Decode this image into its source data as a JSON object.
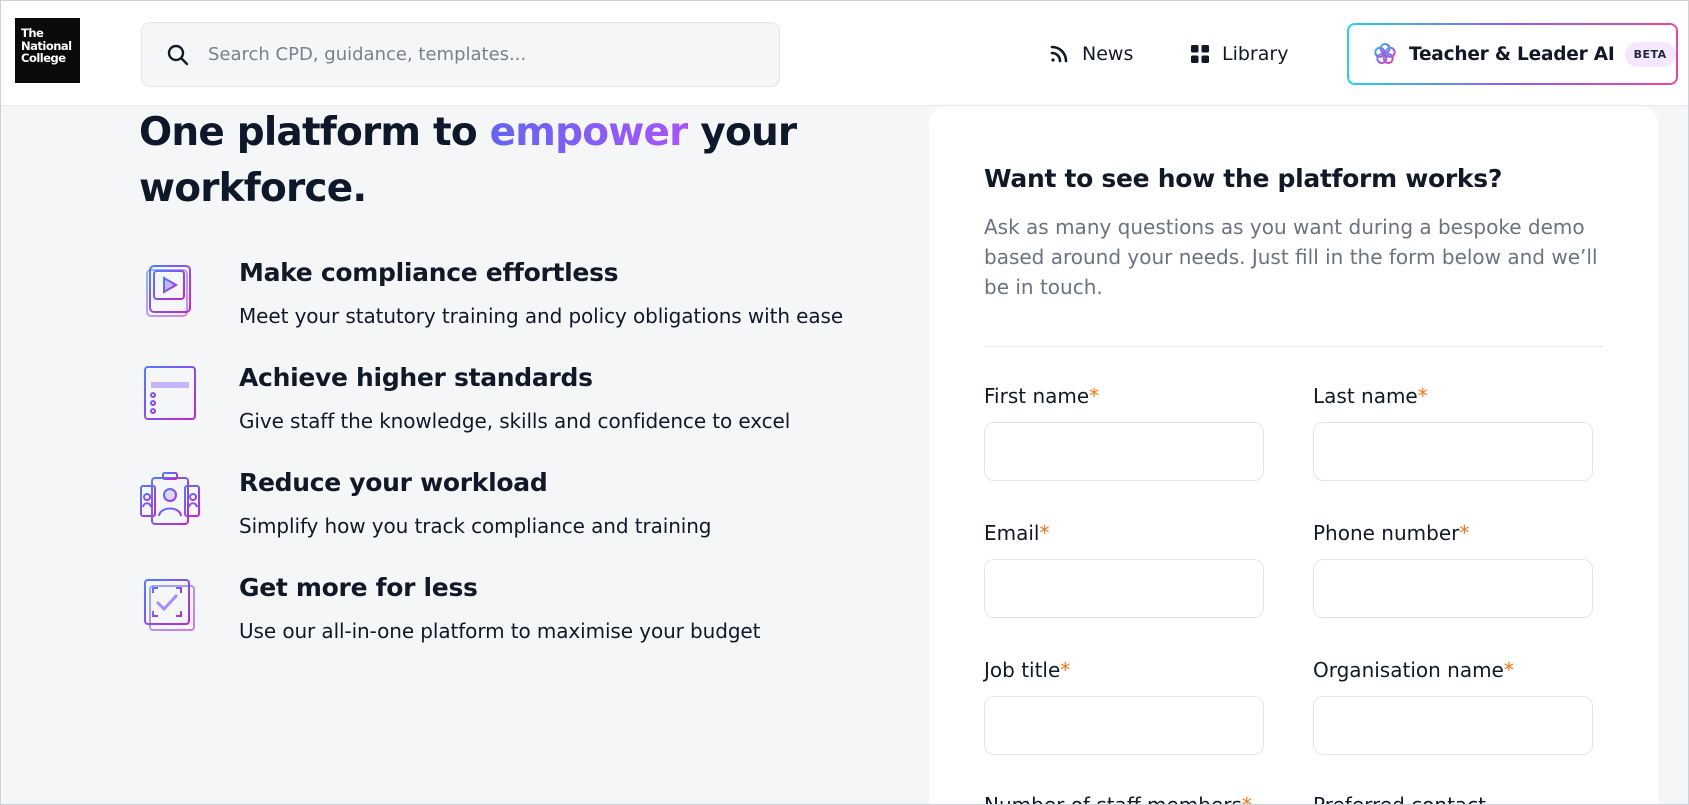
{
  "header": {
    "logo_lines": [
      "The",
      "National",
      "College"
    ],
    "search_placeholder": "Search CPD, guidance, templates...",
    "nav": {
      "news": "News",
      "library": "Library",
      "ai_label": "Teacher & Leader AI",
      "ai_badge": "BETA"
    }
  },
  "hero": {
    "title_before": "One platform to ",
    "title_accent": "empower",
    "title_after": " your workforce."
  },
  "features": [
    {
      "title": "Make compliance effortless",
      "description": "Meet your statutory training and policy obligations with ease",
      "icon": "video-player-icon"
    },
    {
      "title": "Achieve higher standards",
      "description": "Give staff the knowledge, skills and confidence to excel",
      "icon": "browser-list-icon"
    },
    {
      "title": "Reduce your workload",
      "description": "Simplify how you track compliance and training",
      "icon": "staff-id-cards-icon"
    },
    {
      "title": "Get more for less",
      "description": "Use our all-in-one platform to maximise your budget",
      "icon": "checkbox-stack-icon"
    }
  ],
  "form": {
    "heading": "Want to see how the platform works?",
    "intro": "Ask as many questions as you want during a bespoke demo based around your needs. Just fill in the form below and we’ll be in touch.",
    "required_marker": "*",
    "fields": {
      "first_name": "First name",
      "last_name": "Last name",
      "email": "Email",
      "phone": "Phone number",
      "job_title": "Job title",
      "organisation": "Organisation name",
      "staff_count": "Number of staff members",
      "preferred_contact": "Preferred contact"
    }
  },
  "colors": {
    "accent_gradient_start": "#6366f1",
    "accent_gradient_end": "#a855f7",
    "required": "#f97316",
    "page_bg": "#f5f6f8"
  }
}
